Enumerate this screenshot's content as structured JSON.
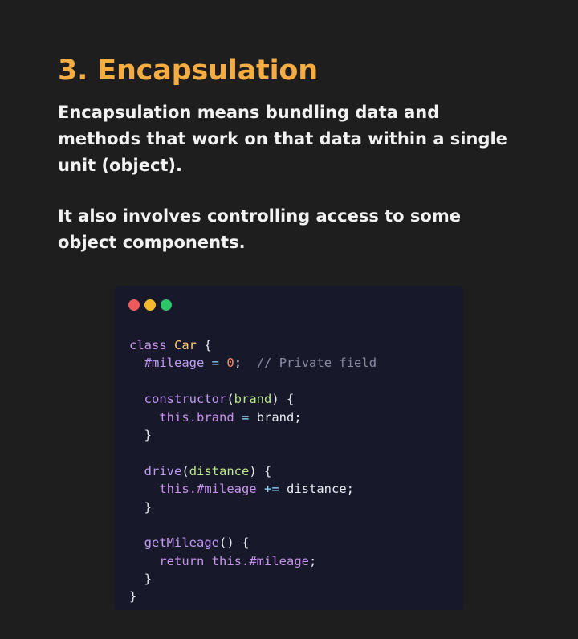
{
  "title": "3. Encapsulation",
  "paragraph1": {
    "line1": "Encapsulation means bundling data and",
    "line2": "methods that work on that data within a single",
    "line3": "unit (object)."
  },
  "paragraph2": {
    "line1": "It also involves controlling access to some",
    "line2": "object components."
  },
  "window": {
    "dot_colors": [
      "#f05a5a",
      "#f5b92e",
      "#2ec46a"
    ]
  },
  "code": {
    "l1": {
      "kw": "class",
      "name": "Car",
      "brace": "{"
    },
    "l2": {
      "field": "#mileage",
      "op": "=",
      "num": "0",
      "semi": ";",
      "comment": "// Private field"
    },
    "l4": {
      "fn": "constructor",
      "open": "(",
      "param": "brand",
      "close": ")",
      "brace": "{"
    },
    "l5": {
      "kw": "this",
      "prop": ".brand",
      "op": "=",
      "rest": "brand;"
    },
    "l6": {
      "brace": "}"
    },
    "l8": {
      "fn": "drive",
      "open": "(",
      "param": "distance",
      "close": ")",
      "brace": "{"
    },
    "l9": {
      "kw": "this",
      "prop": ".#mileage",
      "op": "+=",
      "rest": "distance;"
    },
    "l10": {
      "brace": "}"
    },
    "l12": {
      "fn": "getMileage",
      "parens": "()",
      "brace": "{"
    },
    "l13": {
      "kw": "return",
      "kw2": "this",
      "prop": ".#mileage",
      "semi": ";"
    },
    "l14": {
      "brace": "}"
    },
    "l15": {
      "brace": "}"
    }
  }
}
